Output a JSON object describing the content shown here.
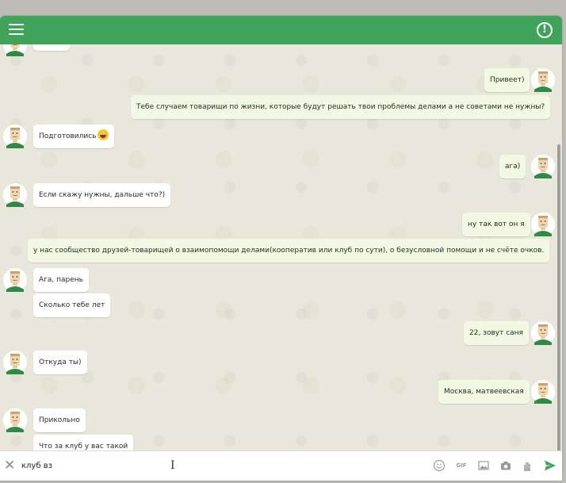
{
  "colors": {
    "accent": "#3fa35a",
    "incoming_bubble": "#ffffff",
    "outgoing_bubble": "#f2f8e3",
    "background": "#e9e7dc"
  },
  "header": {
    "menu_icon": "hamburger-icon",
    "info_icon": "info-icon",
    "info_glyph": "!"
  },
  "messages": [
    {
      "side": "out",
      "text": "Привеет)"
    },
    {
      "side": "out",
      "text": "Тебе случаем товарищи по жизни, которые будут решать твои проблемы делами а не советами не нужны?"
    },
    {
      "side": "in",
      "text": "Подготовились",
      "emoji": "laughing-emoji"
    },
    {
      "side": "out",
      "text": "ага)"
    },
    {
      "side": "in",
      "text": "Если скажу нужны, дальше что?)"
    },
    {
      "side": "out",
      "text": "ну так вот он я"
    },
    {
      "side": "out",
      "text": "у нас сообщество друзей-товарищей о взаимопомощи делами(кооператив или клуб по сути), о безусловной помощи и не счёте очков."
    },
    {
      "side": "in",
      "text": "Ага, парень"
    },
    {
      "side": "in",
      "text": "Сколько тебе лет"
    },
    {
      "side": "out",
      "text": "22, зовут саня"
    },
    {
      "side": "in",
      "text": "Откуда ты)"
    },
    {
      "side": "out",
      "text": "Москва, матвеевская"
    },
    {
      "side": "in",
      "text": "Прикольно"
    },
    {
      "side": "in",
      "text": "Что за клуб у вас такой"
    }
  ],
  "composer": {
    "close_icon": "close-icon",
    "close_glyph": "✕",
    "input_value": "клуб вз",
    "text_cursor_glyph": "I",
    "gif_label": "GIF",
    "icons": [
      "emoji-icon",
      "gif-icon",
      "image-icon",
      "camera-icon",
      "sticker-icon",
      "send-icon"
    ]
  }
}
